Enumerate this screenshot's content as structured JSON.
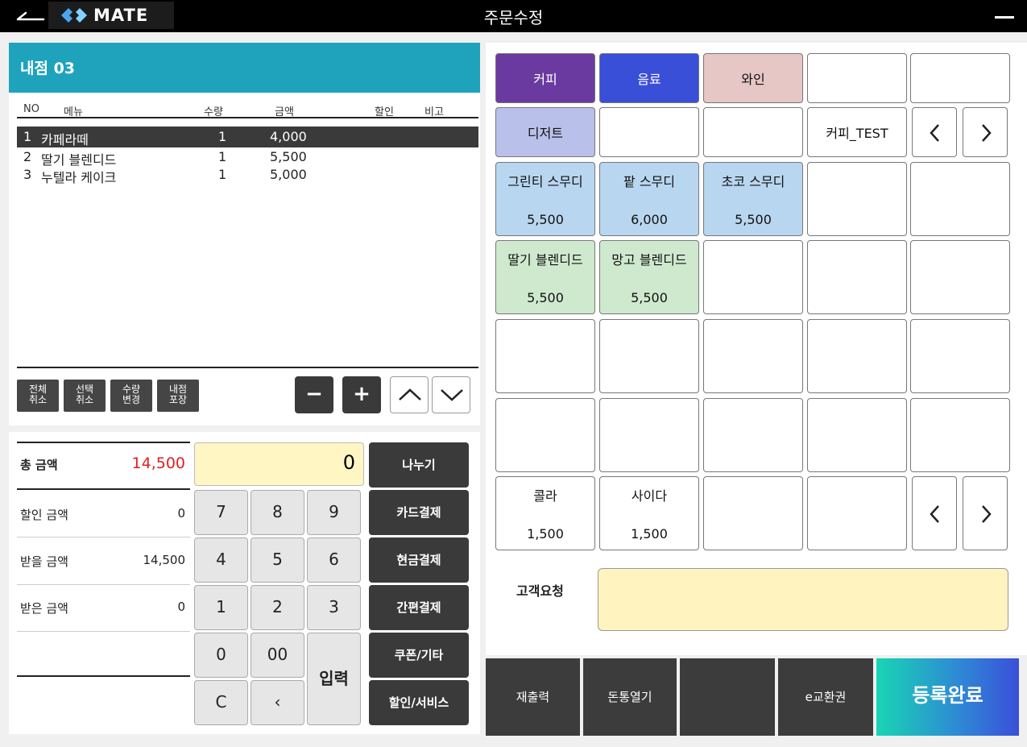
{
  "topbar": {
    "logo": "MATE",
    "title": "주문수정"
  },
  "order": {
    "table_name": "내점 03",
    "columns": [
      "NO",
      "메뉴",
      "수량",
      "금액",
      "할인",
      "비고"
    ],
    "items": [
      {
        "no": "1",
        "menu": "카페라떼",
        "qty": "1",
        "amount": "4,000"
      },
      {
        "no": "2",
        "menu": "딸기 블렌디드",
        "qty": "1",
        "amount": "5,500"
      },
      {
        "no": "3",
        "menu": "누텔라 케이크",
        "qty": "1",
        "amount": "5,000"
      }
    ],
    "actions": [
      {
        "l1": "전체",
        "l2": "취소"
      },
      {
        "l1": "선택",
        "l2": "취소"
      },
      {
        "l1": "수량",
        "l2": "변경"
      },
      {
        "l1": "내점",
        "l2": "포장"
      }
    ],
    "minus": "−",
    "plus": "+"
  },
  "summary": {
    "total_label": "총 금액",
    "total_value": "14,500",
    "discount_label": "할인 금액",
    "discount_value": "0",
    "due_label": "받을 금액",
    "due_value": "14,500",
    "received_label": "받은 금액",
    "received_value": "0"
  },
  "keypad": {
    "display": "0",
    "keys": [
      "7",
      "8",
      "9",
      "4",
      "5",
      "6",
      "1",
      "2",
      "3",
      "0",
      "00",
      "C",
      "‹"
    ],
    "enter": "입력"
  },
  "payments": [
    "나누기",
    "카드결제",
    "현금결제",
    "간편결제",
    "쿠폰/기타",
    "할인/서비스"
  ],
  "menu": {
    "categories": [
      {
        "label": "커피",
        "color": "#6a3aa0",
        "text": "#ffffff"
      },
      {
        "label": "음료",
        "color": "#3a4fd8",
        "text": "#ffffff"
      },
      {
        "label": "와인",
        "color": "#e7c6c6",
        "text": "#111111"
      },
      {
        "label": "디저트",
        "color": "#b9c0ea",
        "text": "#111111"
      },
      {
        "label": "커피_TEST",
        "color": "#ffffff",
        "text": "#111111"
      }
    ],
    "items": [
      {
        "name": "그린티 스무디",
        "price": "5,500",
        "color": "#b9d6f0"
      },
      {
        "name": "팥 스무디",
        "price": "6,000",
        "color": "#b9d6f0"
      },
      {
        "name": "초코 스무디",
        "price": "5,500",
        "color": "#b9d6f0"
      },
      {
        "name": "딸기 블렌디드",
        "price": "5,500",
        "color": "#cfe9cf"
      },
      {
        "name": "망고 블렌디드",
        "price": "5,500",
        "color": "#cfe9cf"
      },
      {
        "name": "콜라",
        "price": "1,500",
        "color": "#ffffff"
      },
      {
        "name": "사이다",
        "price": "1,500",
        "color": "#ffffff"
      }
    ],
    "request_label": "고객요청"
  },
  "bottom": {
    "reprint": "재출력",
    "drawer": "돈통열기",
    "exchange": "e교환권",
    "register": "등록완료"
  }
}
